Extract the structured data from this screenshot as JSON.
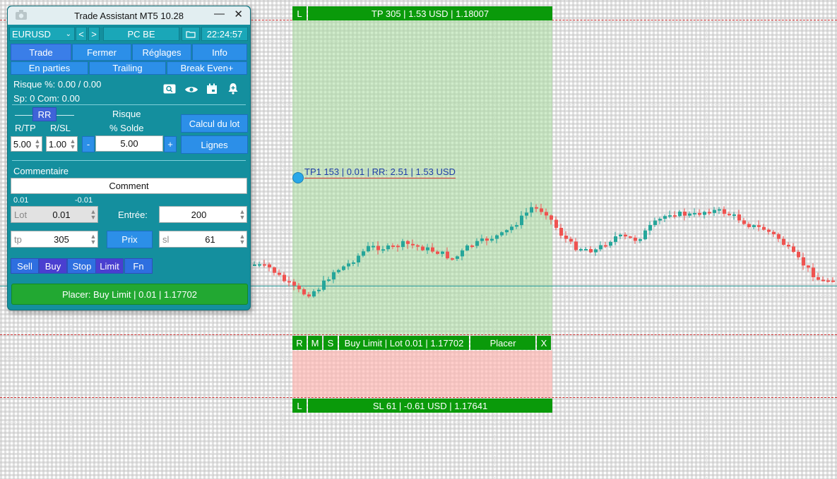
{
  "chart": {
    "tp_bar": {
      "left": "L",
      "main": "TP 305 | 1.53 USD | 1.18007"
    },
    "tp1_label": "TP1 153 | 0.01 | RR: 2.51 | 1.53 USD",
    "order_bar": {
      "r": "R",
      "m": "M",
      "s": "S",
      "info": "Buy Limit | Lot 0.01 | 1.17702",
      "place": "Placer",
      "close": "X"
    },
    "sl_bar": {
      "left": "L",
      "main": "SL 61 | -0.61 USD | 1.17641"
    },
    "colors": {
      "bull": "#26a69a",
      "bear": "#ef5350",
      "tp_zone": "#cce8c6",
      "sl_zone": "#ffcfcc",
      "bar_green": "#0a9a0a"
    }
  },
  "panel": {
    "title": "Trade Assistant MT5 10.28",
    "minimize_icon": "minimize-icon",
    "close_icon": "close-icon",
    "symbol": "EURUSD",
    "prev": "<",
    "next": ">",
    "profile": "PC BE",
    "time": "22:24:57",
    "tabs": [
      "Trade",
      "Fermer",
      "Réglages",
      "Info"
    ],
    "subtabs": [
      "En parties",
      "Trailing",
      "Break Even+"
    ],
    "risk_line": "Risque %: 0.00 /  0.00",
    "sp_line": "Sp: 0  Com: 0.00",
    "rr_label": "RR",
    "rtp_label": "R/TP",
    "rsl_label": "R/SL",
    "risque_label": "Risque",
    "solde_label": "% Solde",
    "calc_btn": "Calcul du lot",
    "lines_btn": "Lignes",
    "rtp_value": "5.00",
    "rsl_value": "1.00",
    "minus": "-",
    "plus": "+",
    "risk_value": "5.00",
    "comment_label": "Commentaire",
    "comment_value": "Comment",
    "lot_min": "0.01",
    "lot_minus": "-0.01",
    "lot_prefix": "Lot",
    "lot_value": "0.01",
    "entry_label": "Entrée:",
    "entry_value": "200",
    "tp_prefix": "tp",
    "tp_value": "305",
    "price_btn": "Prix",
    "sl_prefix": "sl",
    "sl_value": "61",
    "order_types": [
      "Sell",
      "Buy",
      "Stop",
      "Limit",
      "Fn"
    ],
    "place_btn": "Placer: Buy Limit | 0.01 | 1.17702"
  }
}
